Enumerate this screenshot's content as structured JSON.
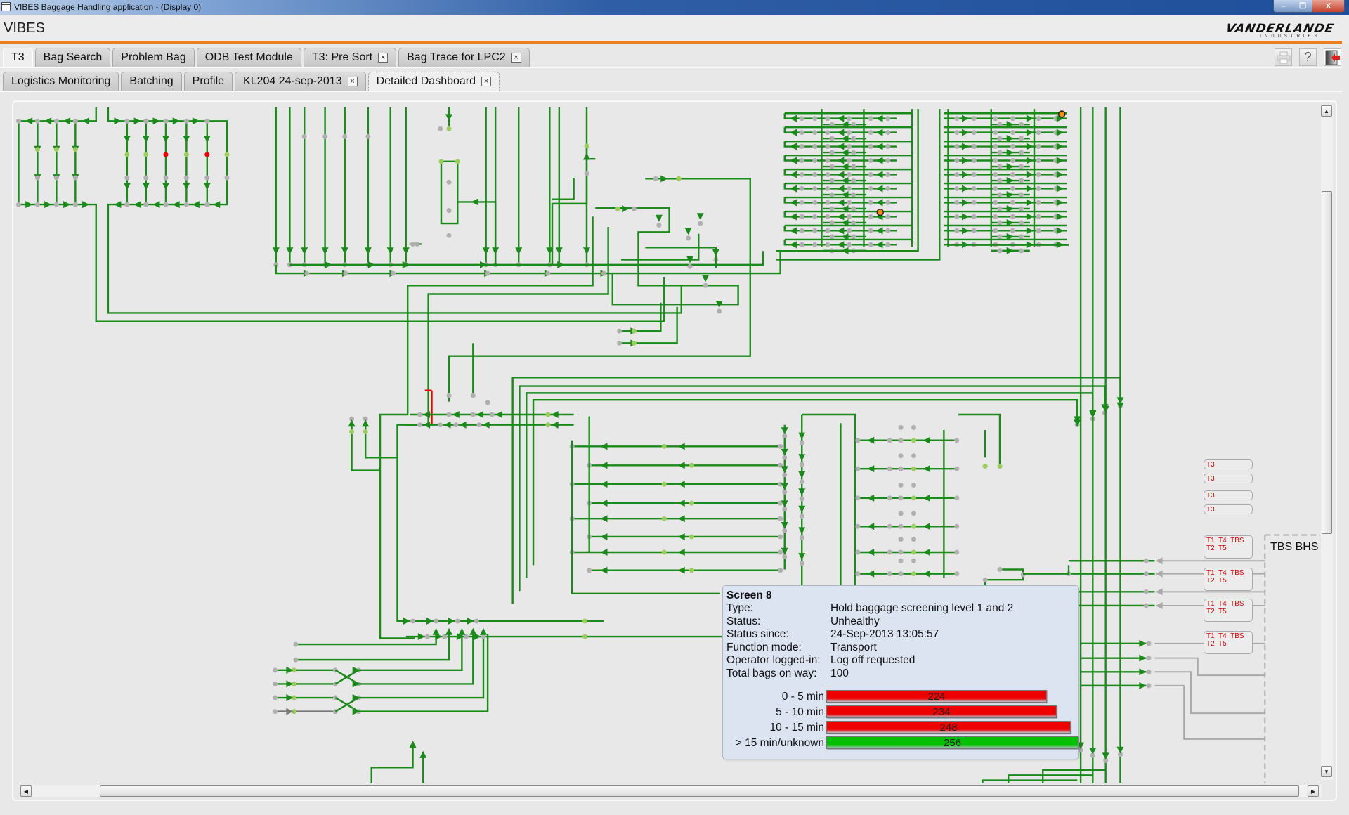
{
  "window": {
    "title": "VIBES Baggage Handling application - (Display 0)",
    "controls": {
      "minimize": "–",
      "restore": "❐",
      "close": "X"
    }
  },
  "header": {
    "app_name": "VIBES",
    "logo_main": "VANDERLANDE",
    "logo_sub": "INDUSTRIES",
    "accent_color": "#ef7d1c"
  },
  "toolbar": {
    "print_icon": "printer-icon",
    "help_label": "?",
    "exit_icon": "exit-door-icon"
  },
  "tabs_row1": [
    {
      "label": "T3",
      "closable": false,
      "active": true
    },
    {
      "label": "Bag Search",
      "closable": false
    },
    {
      "label": "Problem Bag",
      "closable": false
    },
    {
      "label": "ODB Test Module",
      "closable": false
    },
    {
      "label": "T3: Pre Sort",
      "closable": true
    },
    {
      "label": "Bag Trace for LPC2",
      "closable": true
    }
  ],
  "tabs_row2": [
    {
      "label": "Logistics Monitoring",
      "closable": false
    },
    {
      "label": "Batching",
      "closable": false
    },
    {
      "label": "Profile",
      "closable": false
    },
    {
      "label": "KL204 24-sep-2013",
      "closable": true
    },
    {
      "label": "Detailed Dashboard",
      "closable": true,
      "active": true
    }
  ],
  "close_glyph": "×",
  "diagram": {
    "line_color": "#1a8a1a",
    "node_colors": {
      "idle": "#b0b0b0",
      "active": "#9acd5a",
      "error": "#ee0000",
      "alert": "#f08a10"
    },
    "zone_label": "TBS BHS",
    "destinations": [
      {
        "lines": [
          "T3"
        ]
      },
      {
        "lines": [
          "T3"
        ]
      },
      {
        "lines": [
          "T3"
        ]
      },
      {
        "lines": [
          "T3"
        ]
      },
      {
        "lines": [
          "T1  T4  TBS",
          "T2  T5"
        ]
      },
      {
        "lines": [
          "T1  T4  TBS",
          "T2  T5"
        ]
      },
      {
        "lines": [
          "T1  T4  TBS",
          "T2  T5"
        ]
      },
      {
        "lines": [
          "T1  T4  TBS",
          "T2  T5"
        ]
      }
    ]
  },
  "tooltip": {
    "title": "Screen 8",
    "fields": [
      {
        "label": "Type:",
        "value": "Hold baggage screening level 1 and 2"
      },
      {
        "label": "Status:",
        "value": "Unhealthy"
      },
      {
        "label": "Status since:",
        "value": "24-Sep-2013 13:05:57"
      },
      {
        "label": "Function mode:",
        "value": "Transport"
      },
      {
        "label": "Operator logged-in:",
        "value": "Log off requested"
      },
      {
        "label": "Total bags on way:",
        "value": "100"
      }
    ]
  },
  "chart_data": {
    "type": "bar",
    "orientation": "horizontal",
    "title": "",
    "categories": [
      "0 - 5 min",
      "5 - 10 min",
      "10 - 15 min",
      "> 15 min/unknown"
    ],
    "values": [
      224,
      234,
      248,
      256
    ],
    "colors": [
      "#ee0000",
      "#ee0000",
      "#ee0000",
      "#00c000"
    ],
    "xlim": [
      0,
      256
    ],
    "data_labels": true,
    "grid": false
  },
  "scrollbars": {
    "vertical_position": 0.15,
    "horizontal_position": 0.05
  }
}
